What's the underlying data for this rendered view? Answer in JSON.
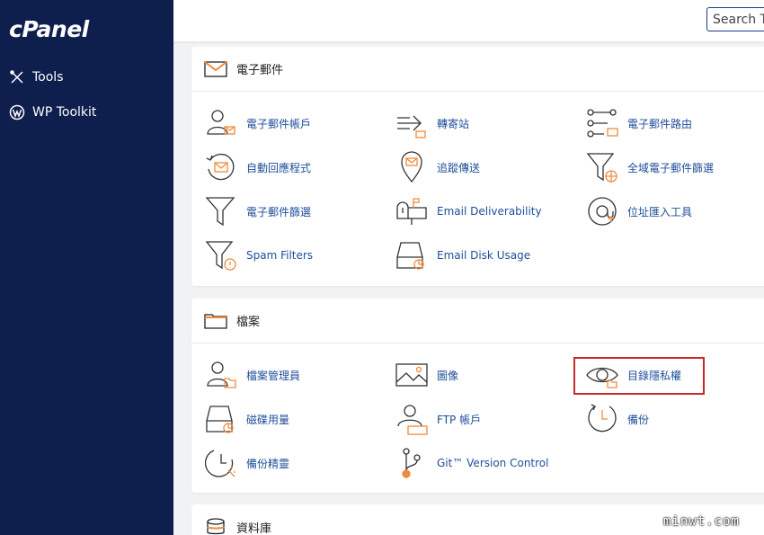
{
  "sidebar": {
    "logo": "cPanel",
    "items": [
      {
        "label": "Tools",
        "icon": "tools-icon"
      },
      {
        "label": "WP Toolkit",
        "icon": "wordpress-icon"
      }
    ]
  },
  "search": {
    "placeholder": "Search Tools"
  },
  "sections": [
    {
      "title": "電子郵件",
      "icon": "envelope-icon",
      "items": [
        {
          "label": "電子郵件帳戶",
          "icon": "email-account-icon"
        },
        {
          "label": "轉寄站",
          "icon": "forwarder-icon"
        },
        {
          "label": "電子郵件路由",
          "icon": "email-routing-icon"
        },
        {
          "label": "自動回應程式",
          "icon": "autoresponder-icon"
        },
        {
          "label": "追蹤傳送",
          "icon": "track-delivery-icon"
        },
        {
          "label": "全域電子郵件篩選",
          "icon": "global-filter-icon"
        },
        {
          "label": "電子郵件篩選",
          "icon": "email-filter-icon"
        },
        {
          "label": "Email Deliverability",
          "icon": "mailbox-icon"
        },
        {
          "label": "位址匯入工具",
          "icon": "address-importer-icon"
        },
        {
          "label": "Spam Filters",
          "icon": "spam-filter-icon"
        },
        {
          "label": "Email Disk Usage",
          "icon": "disk-usage-icon"
        }
      ]
    },
    {
      "title": "檔案",
      "icon": "folder-icon",
      "items": [
        {
          "label": "檔案管理員",
          "icon": "file-manager-icon"
        },
        {
          "label": "圖像",
          "icon": "image-icon"
        },
        {
          "label": "目錄隱私權",
          "icon": "eye-icon"
        },
        {
          "label": "磁碟用量",
          "icon": "disk-icon"
        },
        {
          "label": "FTP 帳戶",
          "icon": "ftp-account-icon"
        },
        {
          "label": "備份",
          "icon": "backup-icon"
        },
        {
          "label": "備份精靈",
          "icon": "backup-wizard-icon"
        },
        {
          "label": "Git™ Version Control",
          "icon": "git-icon"
        }
      ]
    },
    {
      "title": "資料庫",
      "icon": "database-icon",
      "items": []
    }
  ],
  "watermark": "minwt.com",
  "colors": {
    "sidebar": "#0e1e4d",
    "link": "#1f4e9a",
    "accent": "#f08a3a",
    "highlight": "#c8282b"
  }
}
